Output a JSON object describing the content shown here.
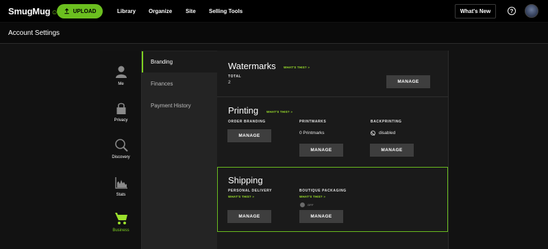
{
  "topbar": {
    "logo": "SmugMug",
    "upload_label": "UPLOAD",
    "nav": [
      "Library",
      "Organize",
      "Site",
      "Selling Tools"
    ],
    "whats_new": "What's New",
    "help": "?"
  },
  "page": {
    "title": "Account Settings"
  },
  "icon_nav": [
    {
      "label": "Me",
      "icon": "person-icon"
    },
    {
      "label": "Privacy",
      "icon": "lock-icon"
    },
    {
      "label": "Discovery",
      "icon": "magnifier-icon"
    },
    {
      "label": "Stats",
      "icon": "stats-chart-icon"
    },
    {
      "label": "Business",
      "icon": "shopping-cart-icon",
      "active": true
    }
  ],
  "sub_nav": [
    {
      "label": "Branding",
      "active": true
    },
    {
      "label": "Finances"
    },
    {
      "label": "Payment History"
    }
  ],
  "watermarks": {
    "title": "Watermarks",
    "whats_this": "WHAT'S THIS? »",
    "total_label": "TOTAL",
    "total_value": "2",
    "manage": "MANAGE"
  },
  "printing": {
    "title": "Printing",
    "whats_this": "WHAT'S THIS? »",
    "order_branding_label": "ORDER BRANDING",
    "printmarks_label": "PRINTMARKS",
    "printmarks_value": "0 Printmarks",
    "backprinting_label": "BACKPRINTING",
    "backprinting_value": "disabled",
    "manage": "MANAGE"
  },
  "shipping": {
    "title": "Shipping",
    "personal_delivery_label": "PERSONAL DELIVERY",
    "personal_whats_this": "WHAT'S THIS? »",
    "boutique_label": "BOUTIQUE PACKAGING",
    "boutique_whats_this": "WHAT'S THIS? »",
    "boutique_toggle": "OFF",
    "manage": "MANAGE"
  },
  "colors": {
    "accent": "#6bbf1f",
    "background": "#121212"
  }
}
